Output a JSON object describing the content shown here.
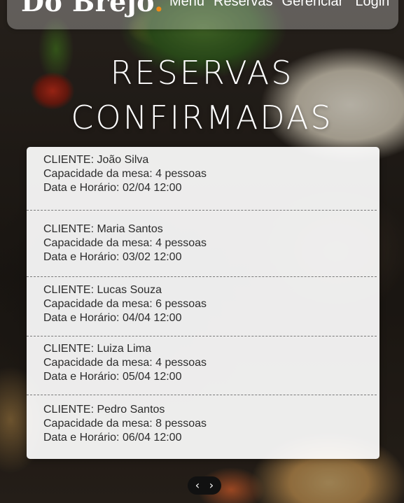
{
  "brand": {
    "name": "Do Brejo",
    "dot": ".",
    "accent_color": "#f28c18"
  },
  "nav": {
    "links": [
      "Menu",
      "Reservas",
      "Gerenciar",
      "Login"
    ]
  },
  "page": {
    "title_line1": "RESERVAS",
    "title_line2": "CONFIRMADAS"
  },
  "reservations": [
    {
      "client": "CLIENTE: João Silva",
      "capacity": "Capacidade da mesa: 4 pessoas",
      "datetime": "Data e Horário: 02/04 12:00"
    },
    {
      "client": "CLIENTE: Maria Santos",
      "capacity": "Capacidade da mesa: 4 pessoas",
      "datetime": "Data e Horário: 03/02 12:00"
    },
    {
      "client": "CLIENTE: Lucas Souza",
      "capacity": "Capacidade da mesa: 6 pessoas",
      "datetime": "Data e Horário: 04/04 12:00"
    },
    {
      "client": "CLIENTE: Luiza Lima",
      "capacity": "Capacidade da mesa: 4 pessoas",
      "datetime": "Data e Horário: 05/04 12:00"
    },
    {
      "client": "CLIENTE: Pedro Santos",
      "capacity": "Capacidade da mesa: 8 pessoas",
      "datetime": "Data e Horário: 06/04 12:00"
    }
  ],
  "pager": {
    "prev": "‹",
    "next": "›",
    "prev_icon": "chevron-left-icon",
    "next_icon": "chevron-right-icon"
  }
}
